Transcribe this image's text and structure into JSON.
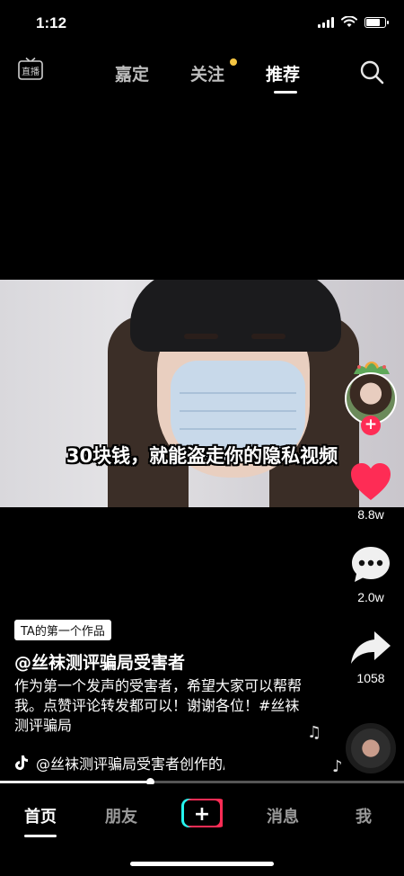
{
  "status_bar": {
    "time": "1:12",
    "battery_level": 0.75
  },
  "top_nav": {
    "live_icon_label": "直播",
    "tabs": [
      {
        "label": "嘉定",
        "active": false
      },
      {
        "label": "关注",
        "active": false,
        "has_dot": true
      },
      {
        "label": "推荐",
        "active": true
      }
    ],
    "search_icon": "search-icon"
  },
  "video": {
    "caption": "30块钱，就能盗走你的隐私视频"
  },
  "actions": {
    "like_count": "8.8w",
    "comment_count": "2.0w",
    "share_count": "1058",
    "follow_symbol": "+"
  },
  "info": {
    "badge": "TA的第一个作品",
    "author": "@丝袜测评骗局受害者",
    "description": "作为第一个发声的受害者，希望大家可以帮帮我。点赞评论转发都可以！谢谢各位！#丝袜测评骗局",
    "music": "@丝袜测评骗局受害者创作的原声"
  },
  "progress": {
    "fraction": 0.37
  },
  "bottom_tabs": [
    {
      "label": "首页",
      "active": true
    },
    {
      "label": "朋友",
      "active": false
    },
    {
      "label": "+",
      "active": false
    },
    {
      "label": "消息",
      "active": false
    },
    {
      "label": "我",
      "active": false
    }
  ],
  "colors": {
    "accent": "#fe2c55",
    "notice_dot": "#f5c542"
  }
}
